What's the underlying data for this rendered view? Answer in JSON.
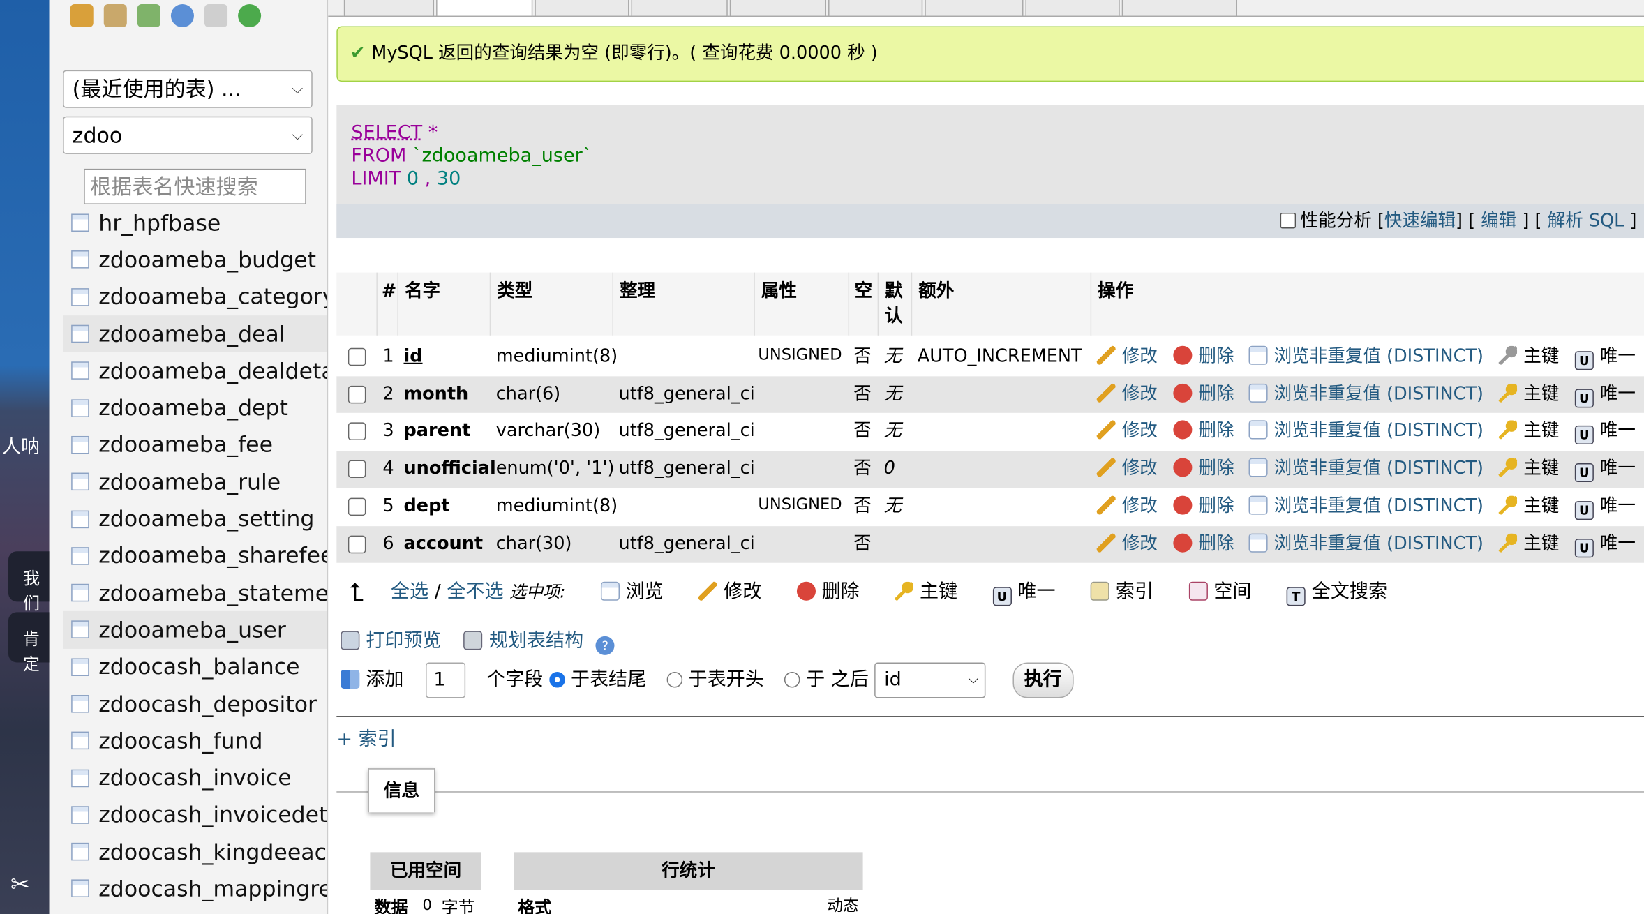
{
  "desktop": {
    "side_text_1": "人呐",
    "side_text_2": "我们",
    "side_text_3": "肯定"
  },
  "nav": {
    "recent_select": "(最近使用的表) ...",
    "db_select": "zdoo",
    "filter_placeholder": "根据表名快速搜索",
    "tables": [
      "hr_hpfbase",
      "zdooameba_budget",
      "zdooameba_category",
      "zdooameba_deal",
      "zdooameba_dealdetail",
      "zdooameba_dept",
      "zdooameba_fee",
      "zdooameba_rule",
      "zdooameba_setting",
      "zdooameba_sharefee",
      "zdooameba_statement",
      "zdooameba_user",
      "zdoocash_balance",
      "zdoocash_depositor",
      "zdoocash_fund",
      "zdoocash_invoice",
      "zdoocash_invoicedetail",
      "zdoocash_kingdeeaccount",
      "zdoocash_mappingrelation"
    ]
  },
  "message": {
    "text": "MySQL 返回的查询结果为空 (即零行)。( 查询花费 0.0000 秒 )"
  },
  "sql": {
    "line1_kw": "SELECT",
    "line1_rest": " *",
    "line2_kw": "FROM",
    "line2_rest": " `zdooameba_user`",
    "line3_kw": "LIMIT",
    "line3_a": " 0",
    "line3_sep": " , ",
    "line3_b": "30",
    "profiling_label": "性能分析",
    "quick_edit": "快速编辑",
    "edit": "编辑",
    "explain": "解析 SQL"
  },
  "structure": {
    "headers": {
      "num": "#",
      "name": "名字",
      "type": "类型",
      "collation": "整理",
      "attributes": "属性",
      "null": "空",
      "default_1": "默",
      "default_2": "认",
      "extra": "额外",
      "action": "操作"
    },
    "rows": [
      {
        "num": "1",
        "name": "id",
        "type": "mediumint(8)",
        "collation": "",
        "attributes": "UNSIGNED",
        "null": "否",
        "default": "无",
        "extra": "AUTO_INCREMENT"
      },
      {
        "num": "2",
        "name": "month",
        "type": "char(6)",
        "collation": "utf8_general_ci",
        "attributes": "",
        "null": "否",
        "default": "无",
        "extra": ""
      },
      {
        "num": "3",
        "name": "parent",
        "type": "varchar(30)",
        "collation": "utf8_general_ci",
        "attributes": "",
        "null": "否",
        "default": "无",
        "extra": ""
      },
      {
        "num": "4",
        "name": "unofficial",
        "type": "enum('0', '1')",
        "collation": "utf8_general_ci",
        "attributes": "",
        "null": "否",
        "default": "0",
        "extra": ""
      },
      {
        "num": "5",
        "name": "dept",
        "type": "mediumint(8)",
        "collation": "",
        "attributes": "UNSIGNED",
        "null": "否",
        "default": "无",
        "extra": ""
      },
      {
        "num": "6",
        "name": "account",
        "type": "char(30)",
        "collation": "utf8_general_ci",
        "attributes": "",
        "null": "否",
        "default": "",
        "extra": ""
      }
    ],
    "actions": {
      "edit": "修改",
      "delete": "删除",
      "distinct": "浏览非重复值 (DISTINCT)",
      "primary": "主键",
      "unique": "唯一"
    }
  },
  "bulk": {
    "check_all": "全选",
    "sep": "/",
    "uncheck_all": "全不选",
    "with_selected": "选中项:",
    "browse": "浏览",
    "edit": "修改",
    "delete": "删除",
    "primary": "主键",
    "unique": "唯一",
    "index": "索引",
    "spatial": "空间",
    "fulltext": "全文搜索"
  },
  "links": {
    "print": "打印预览",
    "propose": "规划表结构"
  },
  "add_column": {
    "label": "添加",
    "count": "1",
    "fields": "个字段",
    "at_end": "于表结尾",
    "at_start": "于表开头",
    "after_prefix": "于",
    "after": "之后",
    "after_column": "id",
    "go": "执行"
  },
  "index_link": "+ 索引",
  "info": {
    "tab": "信息",
    "space_header": "已用空间",
    "row_header": "行统计",
    "data_label": "数据",
    "data_value": "0",
    "data_unit": "字节",
    "format_label": "格式",
    "format_value": "动态"
  }
}
